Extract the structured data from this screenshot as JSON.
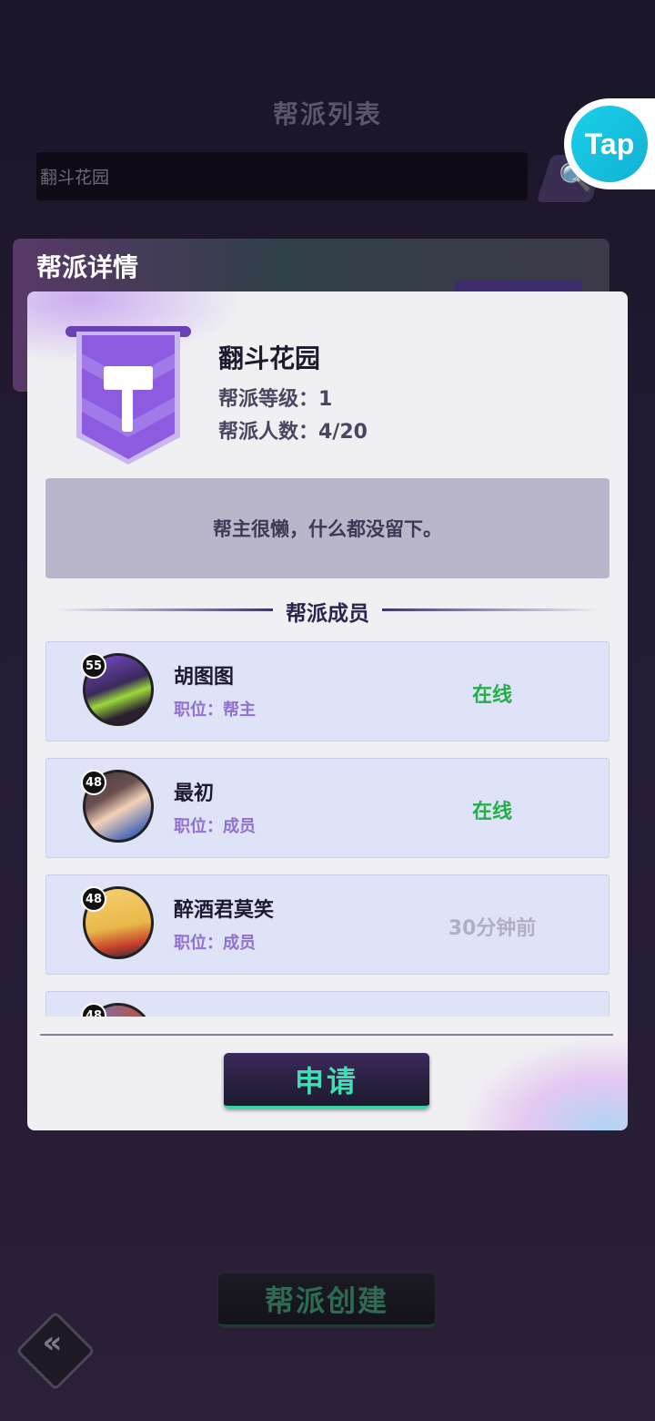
{
  "background": {
    "title": "帮派列表",
    "search_value": "翻斗花园",
    "detail_title": "帮派详情",
    "create_label": "帮派创建",
    "back_glyph": "«",
    "tap_logo": "Tap"
  },
  "guild": {
    "name": "翻斗花园",
    "level_line": "帮派等级：1",
    "members_line": "帮派人数：4/20",
    "notice": "帮主很懒，什么都没留下。",
    "members_header": "帮派成员"
  },
  "members": [
    {
      "level": "55",
      "name": "胡图图",
      "role": "职位：帮主",
      "status": "在线",
      "online": true
    },
    {
      "level": "48",
      "name": "最初",
      "role": "职位：成员",
      "status": "在线",
      "online": true
    },
    {
      "level": "48",
      "name": "醉酒君莫笑",
      "role": "职位：成员",
      "status": "30分钟前",
      "online": false
    },
    {
      "level": "48",
      "name": "",
      "role": "",
      "status": "",
      "online": false
    }
  ],
  "apply_label": "申请",
  "icons": {
    "search": "search-icon",
    "back": "double-chevron-left-icon",
    "emblem": "hammer-banner-icon"
  },
  "colors": {
    "online": "#22b04a",
    "offline": "#b1b0c0",
    "accent": "#3ee0b2",
    "role": "#9070d0"
  }
}
